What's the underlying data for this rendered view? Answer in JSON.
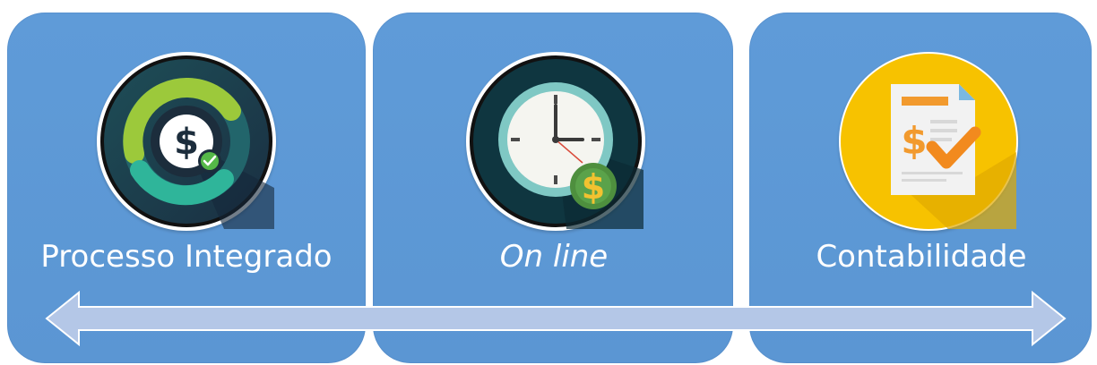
{
  "items": [
    {
      "label": "Processo Integrado",
      "icon": "dollar-ring-icon"
    },
    {
      "label": "On line",
      "icon": "clock-dollar-icon"
    },
    {
      "label": "Contabilidade",
      "icon": "invoice-check-icon"
    }
  ],
  "colors": {
    "card": "#5b96d3",
    "arrow_fill": "#b4c7e7",
    "text": "#ffffff"
  }
}
